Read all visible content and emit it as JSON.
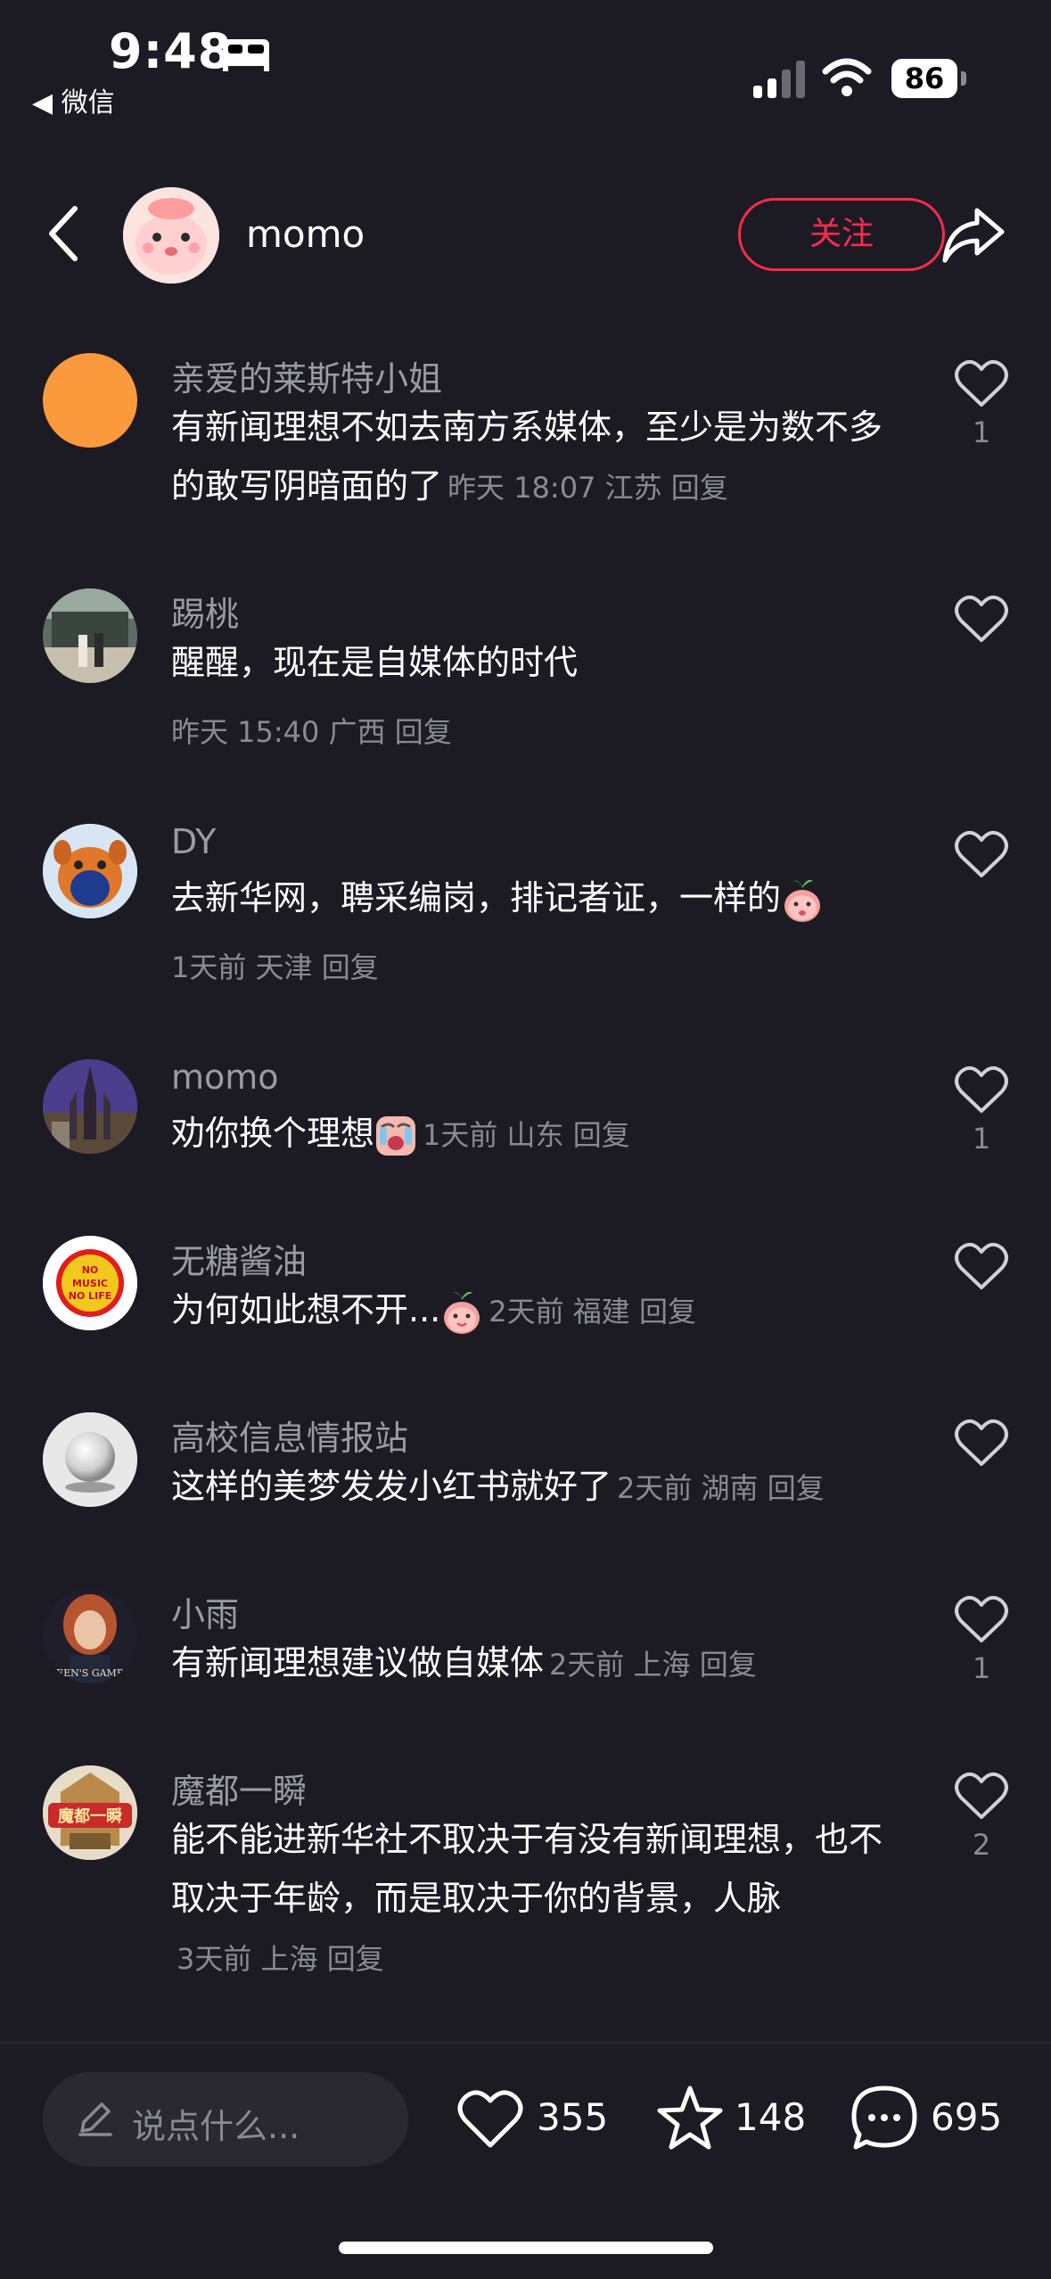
{
  "status_bar": {
    "time": "9:48",
    "back_app_label": "◀ 微信",
    "battery": "86",
    "icons": [
      "bed-icon",
      "signal-icon",
      "wifi-icon",
      "battery-icon"
    ]
  },
  "header": {
    "username": "momo",
    "follow_label": "关注",
    "icons": [
      "back-icon",
      "share-icon"
    ]
  },
  "comments": [
    {
      "name": "亲爱的莱斯特小姐",
      "text": "有新闻理想不如去南方系媒体，至少是为数不多的敢写阴暗面的了",
      "meta": "昨天 18:07 江苏 回复",
      "likes": "1"
    },
    {
      "name": "踢桃",
      "text": "醒醒，现在是自媒体的时代",
      "meta": "昨天 15:40 广西 回复",
      "likes": ""
    },
    {
      "name": "DY",
      "text": "去新华网，聘采编岗，排记者证，一样的",
      "meta": "1天前 天津 回复",
      "likes": ""
    },
    {
      "name": "momo",
      "text": "劝你换个理想",
      "meta": "1天前 山东 回复",
      "likes": "1"
    },
    {
      "name": "无糖酱油",
      "text": "为何如此想不开...",
      "meta": "2天前 福建 回复",
      "likes": ""
    },
    {
      "name": "高校信息情报站",
      "text": "这样的美梦发发小红书就好了",
      "meta": "2天前 湖南 回复",
      "likes": ""
    },
    {
      "name": "小雨",
      "text": "有新闻理想建议做自媒体",
      "meta": "2天前 上海 回复",
      "likes": "1"
    },
    {
      "name": "魔都一瞬",
      "text": "能不能进新华社不取决于有没有新闻理想，也不取决于年龄，而是取决于你的背景，人脉",
      "meta": "3天前 上海 回复",
      "likes": "2"
    }
  ],
  "avatar_texts": {
    "nomusic": "NO MUSIC NO LIFE",
    "queens": "EEN'S GAMB",
    "modu": "魔都一瞬"
  },
  "bottom_bar": {
    "input_placeholder": "说点什么...",
    "like_count": "355",
    "collect_count": "148",
    "comment_count": "695"
  },
  "colors": {
    "background": "#1c1b24",
    "accent_red": "#ff2a4d",
    "secondary_text": "#8a8a92"
  }
}
